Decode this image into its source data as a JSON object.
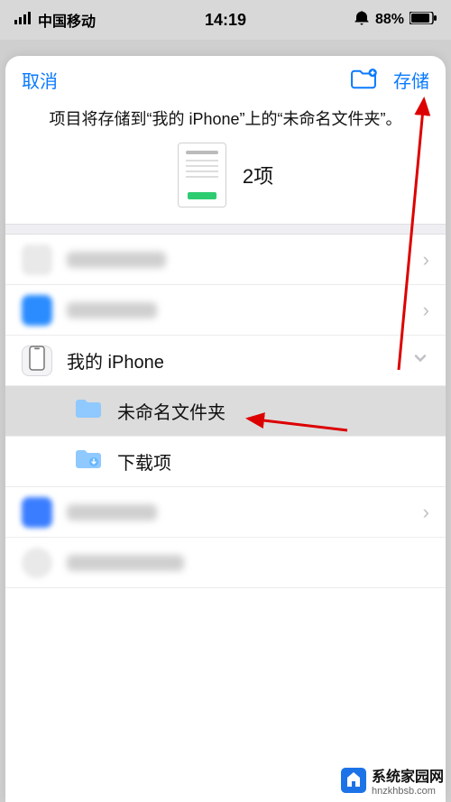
{
  "status": {
    "carrier": "中国移动",
    "time": "14:19",
    "battery": "88%"
  },
  "header": {
    "cancel": "取消",
    "save": "存储"
  },
  "info": "项目将存储到“我的 iPhone”上的“未命名文件夹”。",
  "preview": {
    "count": "2项"
  },
  "rows": {
    "myiphone": "我的 iPhone",
    "untitled": "未命名文件夹",
    "downloads": "下载项"
  },
  "watermark": {
    "text": "系统家园网",
    "url": "hnzkhbsb.com"
  }
}
